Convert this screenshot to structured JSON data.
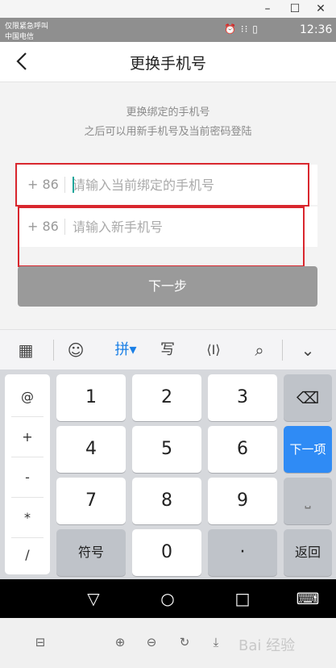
{
  "window": {
    "min_glyph": "–",
    "max_glyph": "☐",
    "close_glyph": "✕"
  },
  "status_bar": {
    "emergency": "仅限紧急呼叫",
    "carrier": "中国电信",
    "icons_glyph": "⏰ ⁝⁝ ▯",
    "time": "12:36"
  },
  "header": {
    "title": "更换手机号",
    "back_icon": "chevron-left-icon"
  },
  "hint": {
    "line1": "更换绑定的手机号",
    "line2": "之后可以用新手机号及当前密码登陆"
  },
  "form": {
    "current_prefix": "+ 86",
    "current_placeholder": "请输入当前绑定的手机号",
    "new_prefix": "+ 86",
    "new_placeholder": "请输入新手机号",
    "next_label": "下一步"
  },
  "ime_toolbar": {
    "grid_glyph": "▦",
    "emoji_glyph": "☺",
    "pinyin_label": "拼▾",
    "handwrite_label": "写",
    "cursor_glyph": "⟨I⟩",
    "search_glyph": "⌕",
    "collapse_glyph": "⌄",
    "accent": "#1a7fe6"
  },
  "keyboard": {
    "symbols": [
      "@",
      "+",
      "-",
      "*",
      "/"
    ],
    "digits": [
      "1",
      "2",
      "3",
      "4",
      "5",
      "6",
      "7",
      "8",
      "9",
      "0"
    ],
    "symbol_key": "符号",
    "dot_key": "·",
    "backspace_glyph": "⌫",
    "next_key": "下一项",
    "space_glyph": "⎵",
    "return_key": "返回"
  },
  "navbar": {
    "back_glyph": "▽",
    "home_glyph": "○",
    "recent_glyph": "□",
    "keyboard_glyph": "⌨"
  },
  "toolbar": {
    "layout_glyph": "⊟",
    "zoom_in_glyph": "⊕",
    "zoom_out_glyph": "⊖",
    "rotate_glyph": "↻",
    "download_glyph": "⤓"
  },
  "watermark": "Bai 经验"
}
